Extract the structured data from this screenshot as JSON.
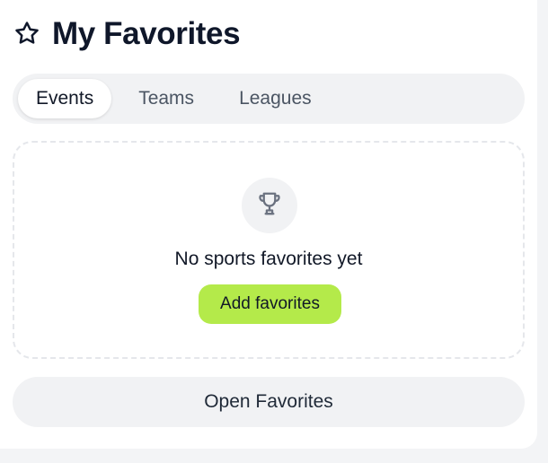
{
  "header": {
    "icon": "star-outline-icon",
    "title": "My Favorites"
  },
  "tabs": [
    {
      "label": "Events",
      "active": true
    },
    {
      "label": "Teams",
      "active": false
    },
    {
      "label": "Leagues",
      "active": false
    }
  ],
  "empty_state": {
    "icon": "trophy-icon",
    "message": "No sports favorites yet",
    "button_label": "Add favorites"
  },
  "footer": {
    "open_button_label": "Open Favorites"
  },
  "colors": {
    "accent": "#b4ea4a",
    "pill_bg": "#f1f2f4",
    "text": "#111827",
    "muted": "#4b5563"
  }
}
